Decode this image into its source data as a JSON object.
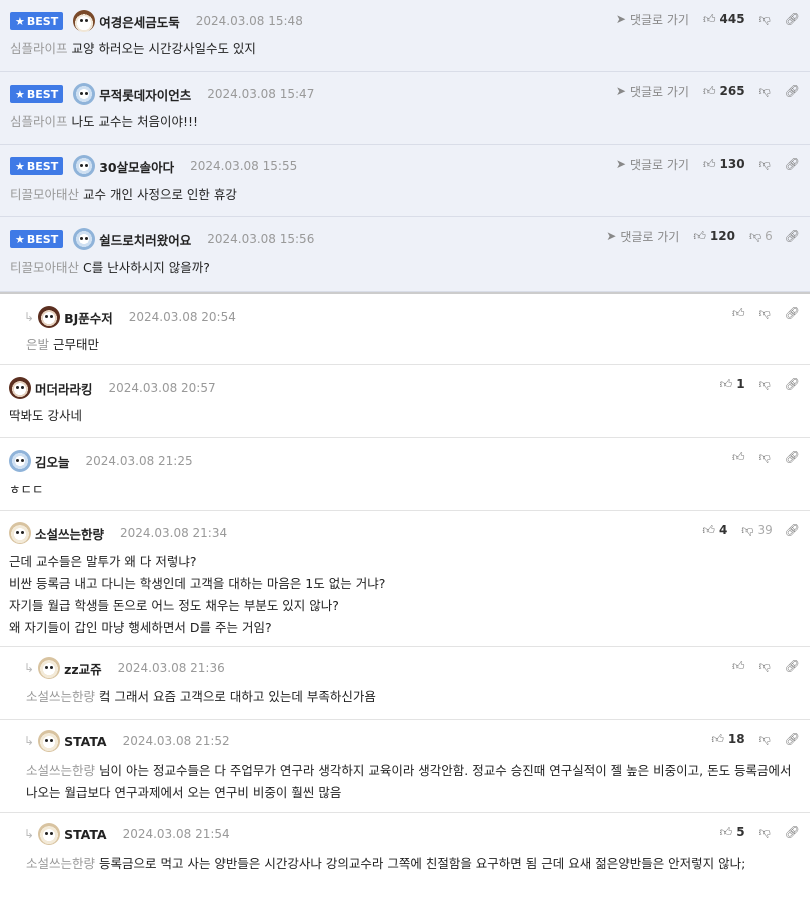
{
  "best_label": "BEST",
  "goto_label": "댓글로 가기",
  "comments": [
    {
      "nick": "여경은세금도둑",
      "date": "2024.03.08 15:48",
      "tag": "심플라이프",
      "text": "교양 하러오는 시간강사일수도 있지",
      "up": "445",
      "down": ""
    },
    {
      "nick": "무적롯데자이언츠",
      "date": "2024.03.08 15:47",
      "tag": "심플라이프",
      "text": "나도 교수는 처음이야!!!",
      "up": "265",
      "down": ""
    },
    {
      "nick": "30살모솔아다",
      "date": "2024.03.08 15:55",
      "tag": "티끌모아태산",
      "text": "교수 개인 사정으로 인한 휴강",
      "up": "130",
      "down": ""
    },
    {
      "nick": "쉴드로치러왔어요",
      "date": "2024.03.08 15:56",
      "tag": "티끌모아태산",
      "text": "C를 난사하시지 않을까?",
      "up": "120",
      "down": "6"
    },
    {
      "nick": "BJ푼수저",
      "date": "2024.03.08 20:54",
      "tag": "은발",
      "text": "근무태만",
      "up": "",
      "down": ""
    },
    {
      "nick": "머더라라킹",
      "date": "2024.03.08 20:57",
      "tag": "",
      "text": "딱봐도 강사네",
      "up": "1",
      "down": ""
    },
    {
      "nick": "김오늘",
      "date": "2024.03.08 21:25",
      "tag": "",
      "text": "ㅎㄷㄷ",
      "up": "",
      "down": ""
    },
    {
      "nick": "소설쓰는한량",
      "date": "2024.03.08 21:34",
      "tag": "",
      "lines": [
        "근데 교수들은 말투가 왜 다 저렇냐?",
        "비싼 등록금 내고 다니는 학생인데 고객을 대하는 마음은 1도 없는 거냐?",
        "자기들 월급 학생들 돈으로 어느 정도 채우는 부분도 있지 않나?",
        "왜 자기들이 갑인 마냥 행세하면서 D를 주는 거임?"
      ],
      "up": "4",
      "down": "39"
    },
    {
      "nick": "zz교쥬",
      "date": "2024.03.08 21:36",
      "tag": "소설쓰는한량",
      "text": "컼 그래서 요즘 고객으로 대하고 있는데 부족하신가욤",
      "up": "",
      "down": ""
    },
    {
      "nick": "STATA",
      "date": "2024.03.08 21:52",
      "tag": "소설쓰는한량",
      "text": "님이 아는 정교수들은 다 주업무가 연구라 생각하지 교육이라 생각안함. 정교수 승진때 연구실적이 젤 높은 비중이고, 돈도 등록금에서 나오는 월급보다 연구과제에서 오는 연구비 비중이 훨씬 많음",
      "up": "18",
      "down": ""
    },
    {
      "nick": "STATA",
      "date": "2024.03.08 21:54",
      "tag": "소설쓰는한량",
      "text": "등록금으로 먹고 사는 양반들은 시간강사나 강의교수라 그쪽에 친절함을 요구하면 됨 근데 요새 젊은양반들은 안저렇지 않나;",
      "up": "5",
      "down": ""
    }
  ]
}
